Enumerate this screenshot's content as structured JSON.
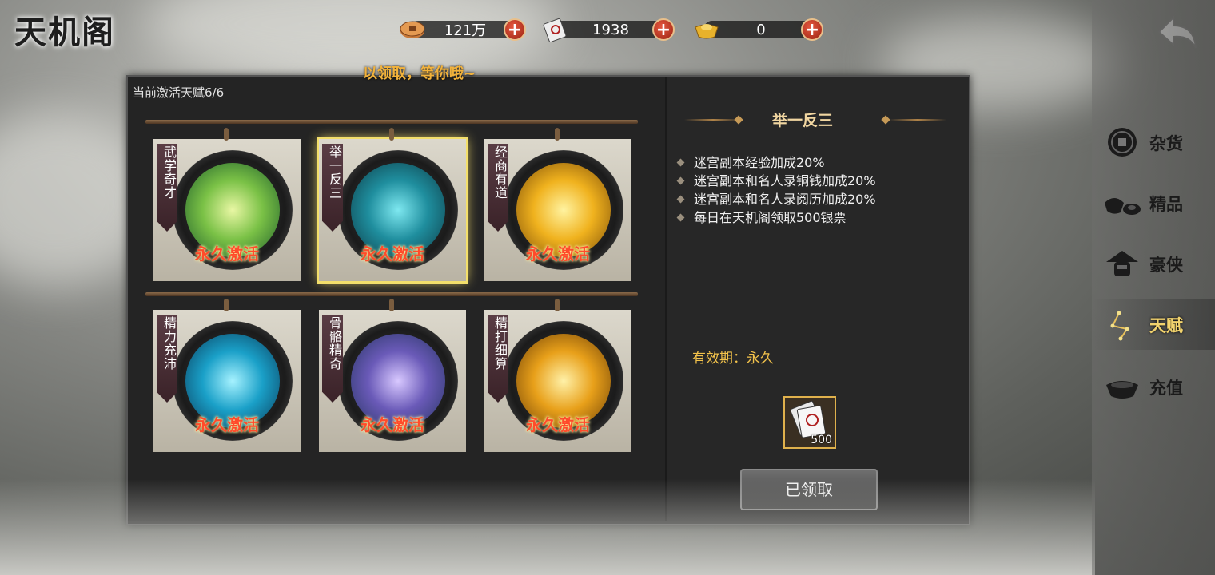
{
  "header": {
    "logo": "天机阁",
    "currencies": [
      {
        "icon": "copper-coin-icon",
        "value": "121万"
      },
      {
        "icon": "silver-note-icon",
        "value": "1938"
      },
      {
        "icon": "gold-ingot-icon",
        "value": "0"
      }
    ],
    "plus_symbol": "+"
  },
  "marquee": "以领取，等你哦~",
  "talents": {
    "active_count": "当前激活天赋6/6",
    "items": [
      {
        "name": "武学奇才",
        "status": "永久激活",
        "selected": false
      },
      {
        "name": "举一反三",
        "status": "永久激活",
        "selected": true
      },
      {
        "name": "经商有道",
        "status": "永久激活",
        "selected": false
      },
      {
        "name": "精力充沛",
        "status": "永久激活",
        "selected": false
      },
      {
        "name": "骨骼精奇",
        "status": "永久激活",
        "selected": false
      },
      {
        "name": "精打细算",
        "status": "永久激活",
        "selected": false
      }
    ]
  },
  "detail": {
    "title": "举一反三",
    "bonuses": [
      "迷宫副本经验加成20%",
      "迷宫副本和名人录铜钱加成20%",
      "迷宫副本和名人录阅历加成20%",
      "每日在天机阁领取500银票"
    ],
    "validity": "有效期：永久",
    "reward": {
      "icon": "silver-note-icon",
      "quantity": "500"
    },
    "claim_button": "已领取"
  },
  "sidebar": {
    "items": [
      {
        "label": "杂货",
        "icon": "coin-icon",
        "active": false
      },
      {
        "label": "精品",
        "icon": "ingot-icon",
        "active": false
      },
      {
        "label": "豪侠",
        "icon": "hero-hat-icon",
        "active": false
      },
      {
        "label": "天赋",
        "icon": "constellation-icon",
        "active": true
      },
      {
        "label": "充值",
        "icon": "treasure-bowl-icon",
        "active": false
      }
    ]
  },
  "colors": {
    "accent": "#f2d36d",
    "status_red": "#ff4b2b",
    "panel": "#272727"
  }
}
